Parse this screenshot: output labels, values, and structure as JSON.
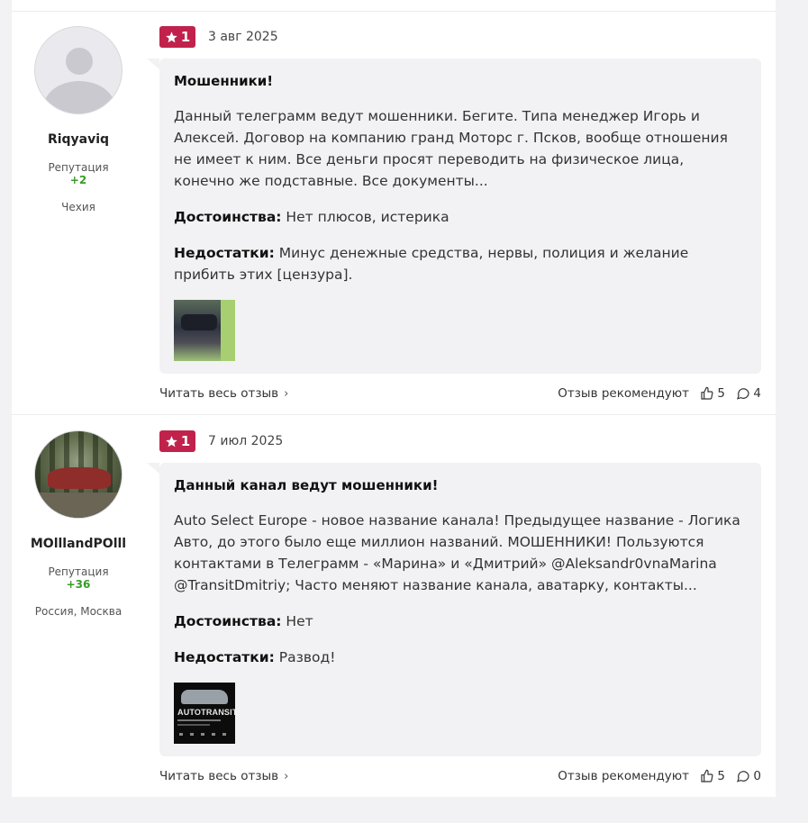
{
  "reviews": [
    {
      "author": {
        "name": "Riqyaviq",
        "rep_label": "Репутация",
        "rep_value": "+2",
        "location": "Чехия"
      },
      "rating": "1",
      "date": "3 авг 2025",
      "title": "Мошенники!",
      "text": "Данный телеграмм ведут мошенники. Бегите. Типа менеджер Игорь и Алексей. Договор на компанию гранд Моторс г. Псков, вообще отношения не имеет к ним. Все деньги просят переводить на физическое лица, конечно же подставные. Все документы...",
      "pros_label": "Достоинства:",
      "pros": "Нет плюсов, истерика",
      "cons_label": "Недостатки:",
      "cons": "Минус денежные средства, нервы, полиция и желание прибить этих [цензура].",
      "read_more": "Читать весь отзыв",
      "recommend_label": "Отзыв рекомендуют",
      "likes": "5",
      "comments": "4"
    },
    {
      "author": {
        "name": "MOlllandPOlll",
        "rep_label": "Репутация",
        "rep_value": "+36",
        "location": "Россия, Москва"
      },
      "rating": "1",
      "date": "7 июл 2025",
      "title": "Данный канал ведут мошенники!",
      "text": "Auto Select Europe - новое название канала! Предыдущее название - Логика Авто, до этого было еще миллион названий. МОШЕННИКИ! Пользуются контактами в Телеграмм - «Марина» и «Дмитрий» @Aleksandr0vnaMarina @TransitDmitriy; Часто меняют название канала, аватарку, контакты...",
      "pros_label": "Достоинства:",
      "pros": "Нет",
      "cons_label": "Недостатки:",
      "cons": "Развод!",
      "image_text": "AUTOTRANSIT",
      "read_more": "Читать весь отзыв",
      "recommend_label": "Отзыв рекомендуют",
      "likes": "5",
      "comments": "0"
    }
  ],
  "colors": {
    "rating_badge": "#c0224b",
    "reputation": "#3a9a2a",
    "bubble": "#f2f2f4"
  }
}
